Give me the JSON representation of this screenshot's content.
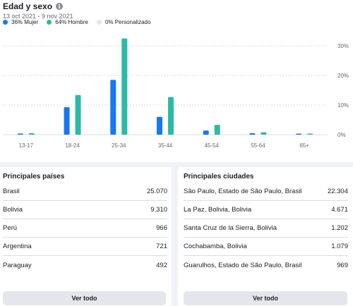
{
  "header": {
    "title": "Edad y sexo",
    "date_range": "13 oct 2021 - 9 nov 2021",
    "info_icon": "info-icon"
  },
  "legend": [
    {
      "label": "36% Mujer",
      "color": "#1877f2"
    },
    {
      "label": "64% Hombre",
      "color": "#2abba7"
    },
    {
      "label": "0% Personalizado",
      "color": "#e4e6eb"
    }
  ],
  "chart_data": {
    "type": "bar",
    "categories": [
      "13-17",
      "18-24",
      "25-34",
      "35-44",
      "45-54",
      "55-64",
      "65+"
    ],
    "series": [
      {
        "name": "Mujer",
        "color": "#1877f2",
        "values": [
          0.4,
          9.3,
          18.5,
          6.0,
          1.4,
          0.5,
          0.2
        ]
      },
      {
        "name": "Hombre",
        "color": "#2abba7",
        "values": [
          0.5,
          13.4,
          32.5,
          12.7,
          3.3,
          0.8,
          0.3
        ]
      }
    ],
    "yticks": [
      "30%",
      "20%",
      "10%",
      "0%"
    ],
    "ylim": [
      0,
      34
    ],
    "grid": "dashed horizontal"
  },
  "countries": {
    "title": "Principales países",
    "rows": [
      {
        "name": "Brasil",
        "value": "25.070"
      },
      {
        "name": "Bolivia",
        "value": "9.310"
      },
      {
        "name": "Perú",
        "value": "966"
      },
      {
        "name": "Argentina",
        "value": "721"
      },
      {
        "name": "Paraguay",
        "value": "492"
      }
    ],
    "button": "Ver todo"
  },
  "cities": {
    "title": "Principales ciudades",
    "rows": [
      {
        "name": "São Paulo, Estado de São Paulo, Brasil",
        "value": "22.304"
      },
      {
        "name": "La Paz, Bolivia, Bolivia",
        "value": "4.671"
      },
      {
        "name": "Santa Cruz de la Sierra, Bolivia",
        "value": "1.202"
      },
      {
        "name": "Cochabamba, Bolivia",
        "value": "1.079"
      },
      {
        "name": "Guarulhos, Estado de São Paulo, Brasil",
        "value": "969"
      }
    ],
    "button": "Ver todo"
  }
}
